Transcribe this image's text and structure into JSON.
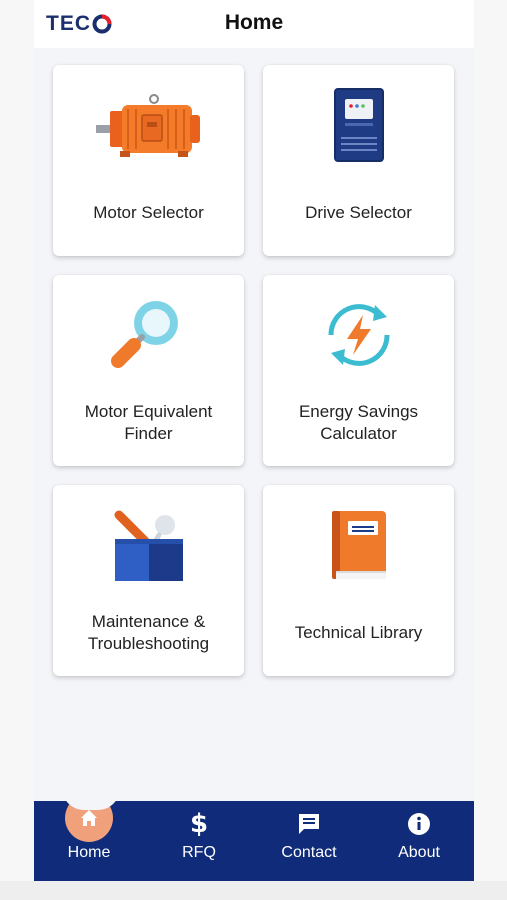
{
  "app": {
    "title": "Home",
    "logo_text": "TEC",
    "brand_blue": "#1b2f6e",
    "brand_red": "#e4202a"
  },
  "tiles": [
    {
      "label_line1": "Motor Selector",
      "label_line2": "",
      "icon": "motor-icon"
    },
    {
      "label_line1": "Drive Selector",
      "label_line2": "",
      "icon": "drive-icon"
    },
    {
      "label_line1": "Motor Equivalent",
      "label_line2": "Finder",
      "icon": "magnifier-icon"
    },
    {
      "label_line1": "Energy Savings",
      "label_line2": "Calculator",
      "icon": "energy-icon"
    },
    {
      "label_line1": "Maintenance &",
      "label_line2": "Troubleshooting",
      "icon": "toolbox-icon"
    },
    {
      "label_line1": "Technical Library",
      "label_line2": "",
      "icon": "book-icon"
    }
  ],
  "nav": {
    "background": "#0f2b7a",
    "items": [
      {
        "label": "Home",
        "icon": "home-icon",
        "active": true
      },
      {
        "label": "RFQ",
        "icon": "dollar-icon",
        "active": false
      },
      {
        "label": "Contact",
        "icon": "chat-icon",
        "active": false
      },
      {
        "label": "About",
        "icon": "info-icon",
        "active": false
      }
    ]
  }
}
